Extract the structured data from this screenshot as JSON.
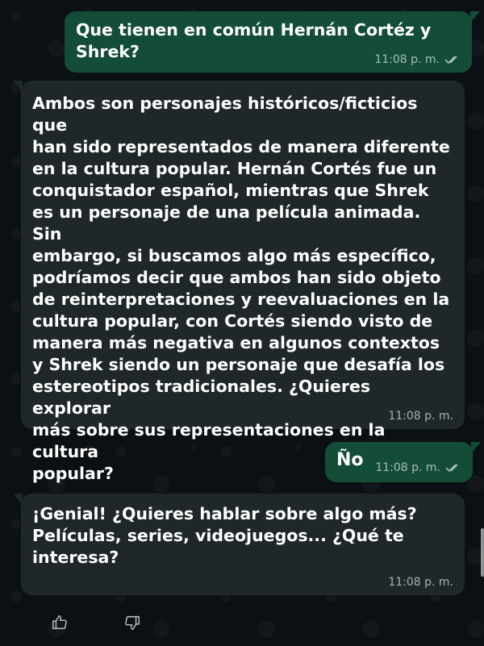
{
  "messages": [
    {
      "id": "m1",
      "direction": "outgoing",
      "text": "Que tienen en común Hernán Cortéz y\nShrek?",
      "time": "11:08 p. m.",
      "status_icon": "double-check-icon"
    },
    {
      "id": "m2",
      "direction": "incoming",
      "text": "Ambos son personajes históricos/ficticios que\nhan sido representados de manera diferente\nen la cultura popular. Hernán Cortés fue un\nconquistador español, mientras que Shrek\nes un personaje de una película animada. Sin\nembargo, si buscamos algo más específico,\npodríamos decir que ambos han sido objeto\nde reinterpretaciones y reevaluaciones en la\ncultura popular, con Cortés siendo visto de\nmanera más negativa en algunos contextos\ny Shrek siendo un personaje que desafía los\nestereotipos tradicionales. ¿Quieres explorar\nmás sobre sus representaciones en la cultura\npopular?",
      "time": "11:08 p. m."
    },
    {
      "id": "m3",
      "direction": "outgoing",
      "text": "Ño",
      "time": "11:08 p. m.",
      "status_icon": "double-check-icon"
    },
    {
      "id": "m4",
      "direction": "incoming",
      "text": "¡Genial! ¿Quieres hablar sobre algo más?\nPelículas, series, videojuegos... ¿Qué te\ninteresa?",
      "time": "11:08 p. m."
    }
  ],
  "reactions": [
    {
      "icon": "thumbs-up-icon"
    },
    {
      "icon": "thumbs-down-icon"
    }
  ],
  "colors": {
    "background": "#0b1014",
    "outgoing_bubble": "#144d37",
    "incoming_bubble": "#1f272a",
    "text": "#ffffff",
    "meta": "#a5abad"
  }
}
